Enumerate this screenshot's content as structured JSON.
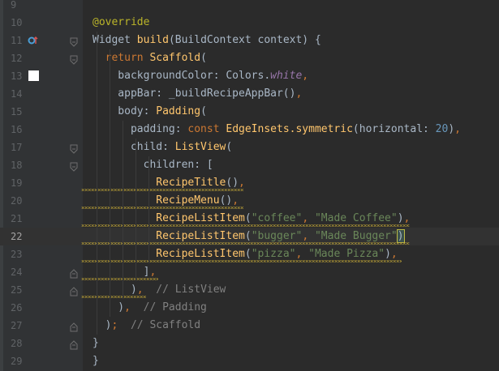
{
  "editor": {
    "lines": [
      {
        "n": "9",
        "text": ""
      },
      {
        "n": "10",
        "tokens": [
          {
            "t": "@override",
            "c": "ann"
          }
        ]
      },
      {
        "n": "11",
        "tokens": [
          {
            "t": "Widget ",
            "c": "named"
          },
          {
            "t": "build",
            "c": "fn"
          },
          {
            "t": "(BuildContext context) {",
            "c": "named"
          }
        ]
      },
      {
        "n": "12",
        "tokens": [
          {
            "t": "  return ",
            "c": "kw"
          },
          {
            "t": "Scaffold",
            "c": "cls"
          },
          {
            "t": "(",
            "c": "named"
          }
        ]
      },
      {
        "n": "13",
        "tokens": [
          {
            "t": "    backgroundColor: Colors.",
            "c": "named"
          },
          {
            "t": "white",
            "c": "field"
          },
          {
            "t": ",",
            "c": "kw"
          }
        ]
      },
      {
        "n": "14",
        "tokens": [
          {
            "t": "    appBar: _buildRecipeAppBar()",
            "c": "named"
          },
          {
            "t": ",",
            "c": "kw"
          }
        ]
      },
      {
        "n": "15",
        "tokens": [
          {
            "t": "    body: ",
            "c": "named"
          },
          {
            "t": "Padding",
            "c": "cls"
          },
          {
            "t": "(",
            "c": "named"
          }
        ]
      },
      {
        "n": "16",
        "tokens": [
          {
            "t": "      padding: ",
            "c": "named"
          },
          {
            "t": "const ",
            "c": "kw"
          },
          {
            "t": "EdgeInsets.",
            "c": "cls"
          },
          {
            "t": "symmetric",
            "c": "fn"
          },
          {
            "t": "(horizontal: ",
            "c": "named"
          },
          {
            "t": "20",
            "c": "num"
          },
          {
            "t": ")",
            "c": "named"
          },
          {
            "t": ",",
            "c": "kw"
          }
        ]
      },
      {
        "n": "17",
        "tokens": [
          {
            "t": "      child: ",
            "c": "named"
          },
          {
            "t": "ListView",
            "c": "cls"
          },
          {
            "t": "(",
            "c": "named"
          }
        ]
      },
      {
        "n": "18",
        "tokens": [
          {
            "t": "        children: [",
            "c": "named"
          }
        ]
      },
      {
        "n": "19",
        "tokens": [
          {
            "t": "          ",
            "c": "named"
          },
          {
            "t": "RecipeTitle",
            "c": "cls"
          },
          {
            "t": "()",
            "c": "named"
          },
          {
            "t": ",",
            "c": "kw"
          }
        ]
      },
      {
        "n": "20",
        "tokens": [
          {
            "t": "          ",
            "c": "named"
          },
          {
            "t": "RecipeMenu",
            "c": "cls"
          },
          {
            "t": "()",
            "c": "named"
          },
          {
            "t": ",",
            "c": "kw"
          }
        ]
      },
      {
        "n": "21",
        "tokens": [
          {
            "t": "          ",
            "c": "named"
          },
          {
            "t": "RecipeListItem",
            "c": "cls"
          },
          {
            "t": "(",
            "c": "named"
          },
          {
            "t": "\"coffee\"",
            "c": "str"
          },
          {
            "t": ", ",
            "c": "kw"
          },
          {
            "t": "\"Made Coffee\"",
            "c": "str"
          },
          {
            "t": ")",
            "c": "named"
          },
          {
            "t": ",",
            "c": "kw"
          }
        ]
      },
      {
        "n": "22",
        "current": true,
        "tokens": [
          {
            "t": "          ",
            "c": "named"
          },
          {
            "t": "RecipeListItem",
            "c": "cls"
          },
          {
            "t": "(",
            "c": "named"
          },
          {
            "t": "\"bugger\"",
            "c": "str"
          },
          {
            "t": ", ",
            "c": "kw"
          },
          {
            "t": "\"Made Bugger\"",
            "c": "str"
          },
          {
            "t": ")",
            "c": "named"
          }
        ]
      },
      {
        "n": "23",
        "tokens": [
          {
            "t": "          ",
            "c": "named"
          },
          {
            "t": "RecipeListItem",
            "c": "cls"
          },
          {
            "t": "(",
            "c": "named"
          },
          {
            "t": "\"pizza\"",
            "c": "str"
          },
          {
            "t": ", ",
            "c": "kw"
          },
          {
            "t": "\"Made Pizza\"",
            "c": "str"
          },
          {
            "t": ")",
            "c": "named"
          },
          {
            "t": ",",
            "c": "kw"
          }
        ]
      },
      {
        "n": "24",
        "tokens": [
          {
            "t": "        ]",
            "c": "named"
          },
          {
            "t": ",",
            "c": "kw"
          }
        ]
      },
      {
        "n": "25",
        "tokens": [
          {
            "t": "      )",
            "c": "named"
          },
          {
            "t": ",",
            "c": "kw"
          },
          {
            "t": "  // ListView",
            "c": "cmt"
          }
        ]
      },
      {
        "n": "26",
        "tokens": [
          {
            "t": "    )",
            "c": "named"
          },
          {
            "t": ",",
            "c": "kw"
          },
          {
            "t": "  // Padding",
            "c": "cmt"
          }
        ]
      },
      {
        "n": "27",
        "tokens": [
          {
            "t": "  )",
            "c": "named"
          },
          {
            "t": ";",
            "c": "kw"
          },
          {
            "t": "  // Scaffold",
            "c": "cmt"
          }
        ]
      },
      {
        "n": "28",
        "tokens": [
          {
            "t": "}",
            "c": "named"
          }
        ]
      },
      {
        "n": "29",
        "tokens": [
          {
            "t": "}",
            "c": "named"
          }
        ]
      }
    ]
  },
  "colors": {
    "background": "#2b2b2b",
    "gutter": "#313335",
    "current_line": "#323232",
    "keyword": "#cc7832",
    "class": "#ffc66d",
    "string": "#6a8759",
    "number": "#6897bb",
    "comment": "#808080",
    "annotation": "#bbb529",
    "field": "#9876aa",
    "warning_underline": "#bfa436"
  },
  "icons": {
    "override_marker": "override-gutter-icon",
    "color_swatch": "color-swatch-icon",
    "fold": "fold-icon"
  }
}
